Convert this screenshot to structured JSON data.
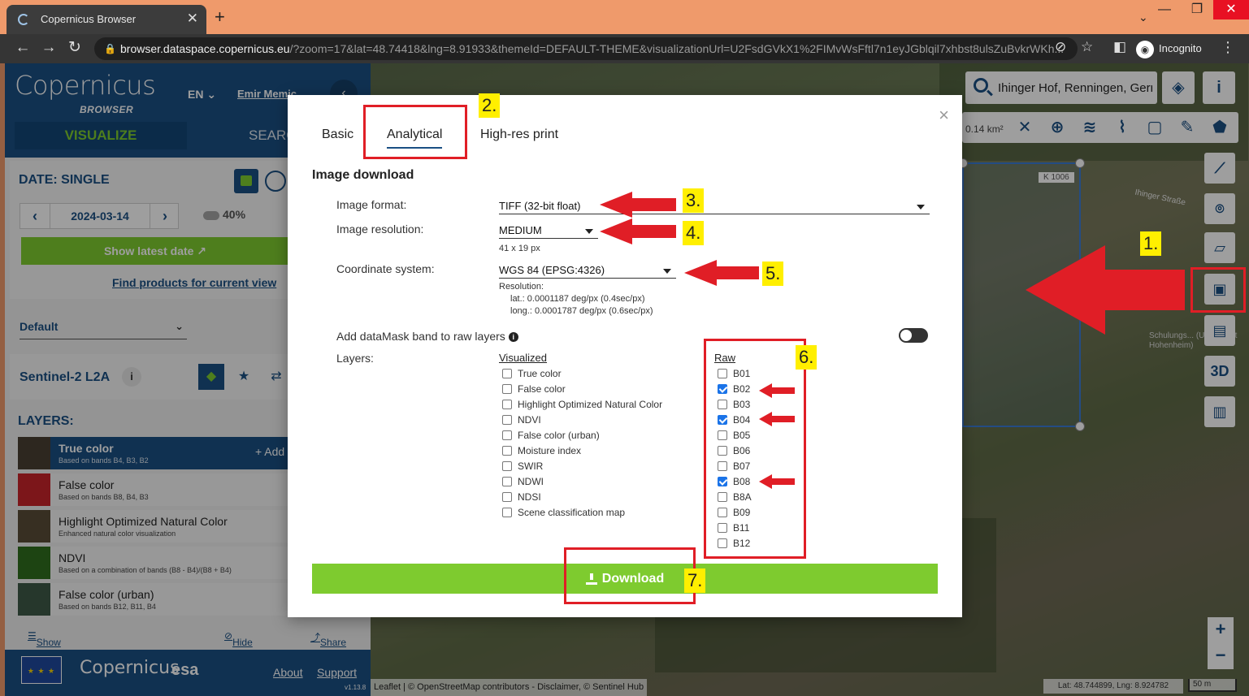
{
  "browser": {
    "tab_title": "Copernicus Browser",
    "tab_close": "✕",
    "new_tab": "+",
    "url_host": "browser.dataspace.copernicus.eu",
    "url_rest": "/?zoom=17&lat=48.74418&lng=8.91933&themeId=DEFAULT-THEME&visualizationUrl=U2FsdGVkX1%2FIMvWsFftl7n1eyJGblqil7xhbst8ulsZuBvkrWKh...",
    "incognito": "Incognito",
    "back": "←",
    "forward": "→",
    "reload": "↻",
    "menu": "⋮"
  },
  "app": {
    "logo": "Copernicus",
    "logo_sub": "BROWSER",
    "lang": "EN",
    "user": "Emir Memic",
    "collapse": "‹",
    "tab_visualize": "VISUALIZE",
    "tab_search": "SEARCH",
    "date_label": "DATE: SINGLE",
    "date_value": "2024-03-14",
    "cloud": "40%",
    "show_latest": "Show latest date",
    "find_products": "Find products for current view",
    "theme": "Default",
    "datasource": "Sentinel-2 L2A",
    "datasource_info": "i",
    "layers_head": "LAYERS:",
    "add": "+ Add",
    "layers": [
      {
        "name": "True color",
        "desc": "Based on bands B4, B3, B2",
        "color": "#4a4032"
      },
      {
        "name": "False color",
        "desc": "Based on bands B8, B4, B3",
        "color": "#c8242a"
      },
      {
        "name": "Highlight Optimized Natural Color",
        "desc": "Enhanced natural color visualization",
        "color": "#5a4d38"
      },
      {
        "name": "NDVI",
        "desc": "Based on a combination of bands (B8 - B4)/(B8 + B4)",
        "color": "#2f6e1e"
      },
      {
        "name": "False color (urban)",
        "desc": "Based on bands B12, B11, B4",
        "color": "#3e5a48"
      }
    ],
    "show_effects": "Show effects and advanced options",
    "hide_layer": "Hide layer",
    "share": "Share",
    "about": "About",
    "support": "Support",
    "version": "v1.13.8",
    "esa": "esa"
  },
  "map": {
    "search": "Ihinger Hof, Renningen, Germany",
    "area": "0.14 km²",
    "road_tag": "K 1006",
    "street": "Ihinger Straße",
    "schule": "Schulungs... (Universität Hohenheim)",
    "btn_3d": "3D",
    "zoom_in": "+",
    "zoom_out": "−",
    "attribution": "Leaflet | © OpenStreetMap contributors - Disclaimer, © Sentinel Hub",
    "coords": "Lat: 48.744899, Lng: 8.924782",
    "scale": "50 m"
  },
  "modal": {
    "close": "×",
    "tabs": [
      "Basic",
      "Analytical",
      "High-res print"
    ],
    "section": "Image download",
    "format_label": "Image format:",
    "format_value": "TIFF (32-bit float)",
    "resolution_label": "Image resolution:",
    "resolution_value": "MEDIUM",
    "resolution_size": "41 x 19 px",
    "crs_label": "Coordinate system:",
    "crs_value": "WGS 84 (EPSG:4326)",
    "res_title": "Resolution:",
    "res_lat": "lat.: 0.0001187 deg/px (0.4sec/px)",
    "res_long": "long.: 0.0001787 deg/px (0.6sec/px)",
    "datamask_label": "Add dataMask band to raw layers",
    "layers_label": "Layers:",
    "visualized_head": "Visualized",
    "raw_head": "Raw",
    "visualized": [
      "True color",
      "False color",
      "Highlight Optimized Natural Color",
      "NDVI",
      "False color (urban)",
      "Moisture index",
      "SWIR",
      "NDWI",
      "NDSI",
      "Scene classification map"
    ],
    "raw": [
      {
        "name": "B01",
        "checked": false
      },
      {
        "name": "B02",
        "checked": true
      },
      {
        "name": "B03",
        "checked": false
      },
      {
        "name": "B04",
        "checked": true
      },
      {
        "name": "B05",
        "checked": false
      },
      {
        "name": "B06",
        "checked": false
      },
      {
        "name": "B07",
        "checked": false
      },
      {
        "name": "B08",
        "checked": true
      },
      {
        "name": "B8A",
        "checked": false
      },
      {
        "name": "B09",
        "checked": false
      },
      {
        "name": "B11",
        "checked": false
      },
      {
        "name": "B12",
        "checked": false
      }
    ],
    "download": "Download"
  },
  "annotations": {
    "tags": [
      "1.",
      "2.",
      "3.",
      "4.",
      "5.",
      "6.",
      "7."
    ],
    "red": "#e01e26",
    "yellow": "#ffef00"
  }
}
